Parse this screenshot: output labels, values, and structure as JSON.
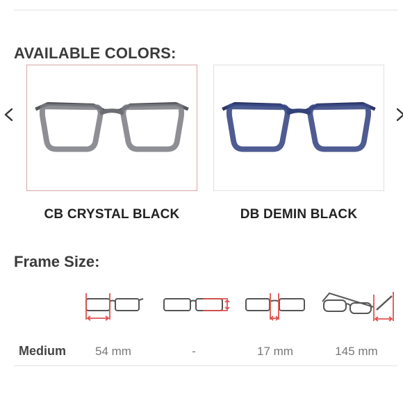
{
  "colors_section": {
    "title": "AVAILABLE COLORS:",
    "swatches": [
      {
        "label": "CB CRYSTAL BLACK",
        "frame_color": "#6c6c73",
        "selected": true
      },
      {
        "label": "DB DEMIN BLACK",
        "frame_color": "#3b4a86",
        "selected": false
      }
    ],
    "selected_border_color": "#d9a5a5"
  },
  "size_section": {
    "title": "Frame Size:",
    "dimension_icons": [
      "lens-width-icon",
      "lens-height-icon",
      "bridge-width-icon",
      "temple-length-icon"
    ],
    "accent_color": "#e05050",
    "row": {
      "name": "Medium",
      "values": [
        "54 mm",
        "-",
        "17 mm",
        "145 mm"
      ]
    }
  }
}
